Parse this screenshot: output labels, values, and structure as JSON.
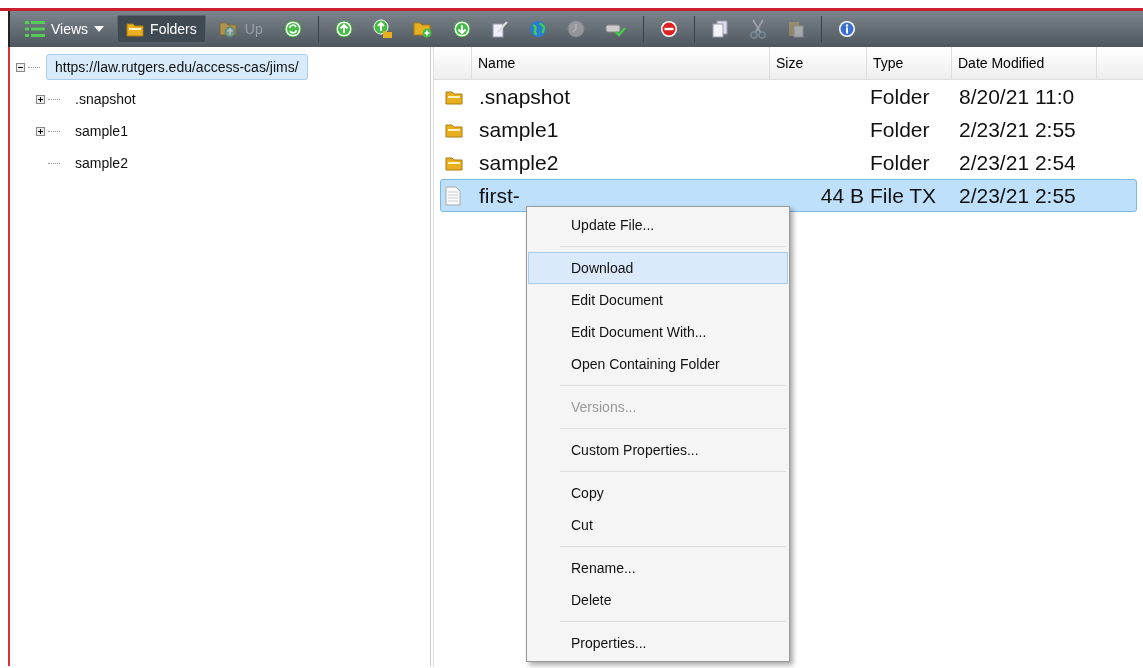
{
  "toolbar": {
    "views": {
      "label": "Views"
    },
    "folders": {
      "label": "Folders",
      "selected": true
    },
    "up": {
      "label": "Up",
      "disabled": true
    },
    "icons": [
      {
        "kind": "refresh",
        "disabled": false
      },
      {
        "kind": "sep"
      },
      {
        "kind": "upload",
        "disabled": false
      },
      {
        "kind": "upload-folder",
        "disabled": false
      },
      {
        "kind": "new-folder",
        "disabled": false
      },
      {
        "kind": "download",
        "disabled": false
      },
      {
        "kind": "edit",
        "disabled": false
      },
      {
        "kind": "globe",
        "disabled": false
      },
      {
        "kind": "clock",
        "disabled": true
      },
      {
        "kind": "checkout",
        "disabled": false
      },
      {
        "kind": "sep"
      },
      {
        "kind": "delete",
        "disabled": false
      },
      {
        "kind": "sep"
      },
      {
        "kind": "copy",
        "disabled": false
      },
      {
        "kind": "cut",
        "disabled": true
      },
      {
        "kind": "paste",
        "disabled": true
      },
      {
        "kind": "sep"
      },
      {
        "kind": "info",
        "disabled": false
      }
    ]
  },
  "tree": {
    "label": "https://law.rutgers.edu/access-cas/jims/",
    "expanded": true,
    "selected": true,
    "children": [
      {
        "label": ".snapshot",
        "expanded": false,
        "selected": false
      },
      {
        "label": "sample1",
        "expanded": false,
        "selected": false
      },
      {
        "label": "sample2",
        "selected": false
      }
    ]
  },
  "table": {
    "columns": [
      "Name",
      "Size",
      "Type",
      "Date Modified"
    ],
    "rows": [
      {
        "kind": "folder",
        "name": ".snapshot",
        "size": "",
        "type": "Folder",
        "date": "8/20/21 11:0",
        "selected": false
      },
      {
        "kind": "folder",
        "name": "sample1",
        "type": "Folder",
        "date": "2/23/21 2:55",
        "selected": false
      },
      {
        "kind": "folder",
        "name": "sample2",
        "type": "Folder",
        "date": "2/23/21 2:54",
        "selected": false
      },
      {
        "kind": "file",
        "name": "first-",
        "size": "44 B",
        "type": "File TX",
        "date": "2/23/21 2:55",
        "selected": true
      }
    ]
  },
  "context_menu": [
    {
      "kind": "item",
      "label": "Update File...",
      "selected": false,
      "disabled": false
    },
    {
      "kind": "separator"
    },
    {
      "kind": "item",
      "label": "Download",
      "selected": true,
      "disabled": false
    },
    {
      "kind": "item",
      "label": "Edit Document",
      "selected": false,
      "disabled": false
    },
    {
      "kind": "item",
      "label": "Edit Document With...",
      "selected": false,
      "disabled": false
    },
    {
      "kind": "item",
      "label": "Open Containing Folder",
      "selected": false,
      "disabled": false
    },
    {
      "kind": "separator"
    },
    {
      "kind": "item",
      "label": "Versions...",
      "selected": false,
      "disabled": true
    },
    {
      "kind": "separator"
    },
    {
      "kind": "item",
      "label": "Custom Properties...",
      "selected": false,
      "disabled": false
    },
    {
      "kind": "separator"
    },
    {
      "kind": "item",
      "label": "Copy",
      "selected": false,
      "disabled": false
    },
    {
      "kind": "item",
      "label": "Cut",
      "selected": false,
      "disabled": false
    },
    {
      "kind": "separator"
    },
    {
      "kind": "item",
      "label": "Rename...",
      "selected": false,
      "disabled": false
    },
    {
      "kind": "item",
      "label": "Delete",
      "selected": false,
      "disabled": false
    },
    {
      "kind": "separator"
    },
    {
      "kind": "item",
      "label": "Properties...",
      "selected": false,
      "disabled": false
    }
  ]
}
